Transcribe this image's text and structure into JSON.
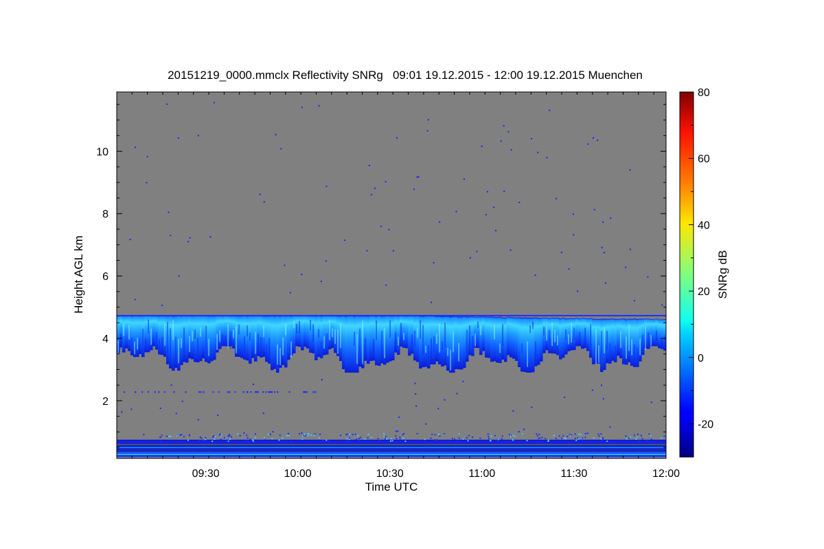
{
  "chart_data": {
    "type": "heatmap",
    "title": "20151219_0000.mmclx Reflectivity SNRg   09:01 19.12.2015 - 12:00 19.12.2015 Muenchen",
    "xlabel": "Time UTC",
    "ylabel": "Height AGL km",
    "xlim": [
      "09:01",
      "12:00"
    ],
    "ylim": [
      0.15,
      11.9
    ],
    "x_ticks": [
      "09:30",
      "10:00",
      "10:30",
      "11:00",
      "11:30",
      "12:00"
    ],
    "y_ticks": [
      "2",
      "4",
      "6",
      "8",
      "10"
    ],
    "colorbar": {
      "label": "SNRg dB",
      "range": [
        -30,
        80
      ],
      "ticks": [
        "-20",
        "0",
        "20",
        "40",
        "60",
        "80"
      ],
      "colormap": "jet"
    },
    "background_color": "#808080",
    "features": [
      {
        "name": "cloud layer",
        "base_km": 3.0,
        "top_km": 4.75,
        "snr_db_min": -20,
        "snr_db_max": 10
      },
      {
        "name": "near-surface clutter",
        "base_km": 0.2,
        "top_km": 0.75,
        "snr_db_min": -20,
        "snr_db_max": 10
      }
    ]
  }
}
